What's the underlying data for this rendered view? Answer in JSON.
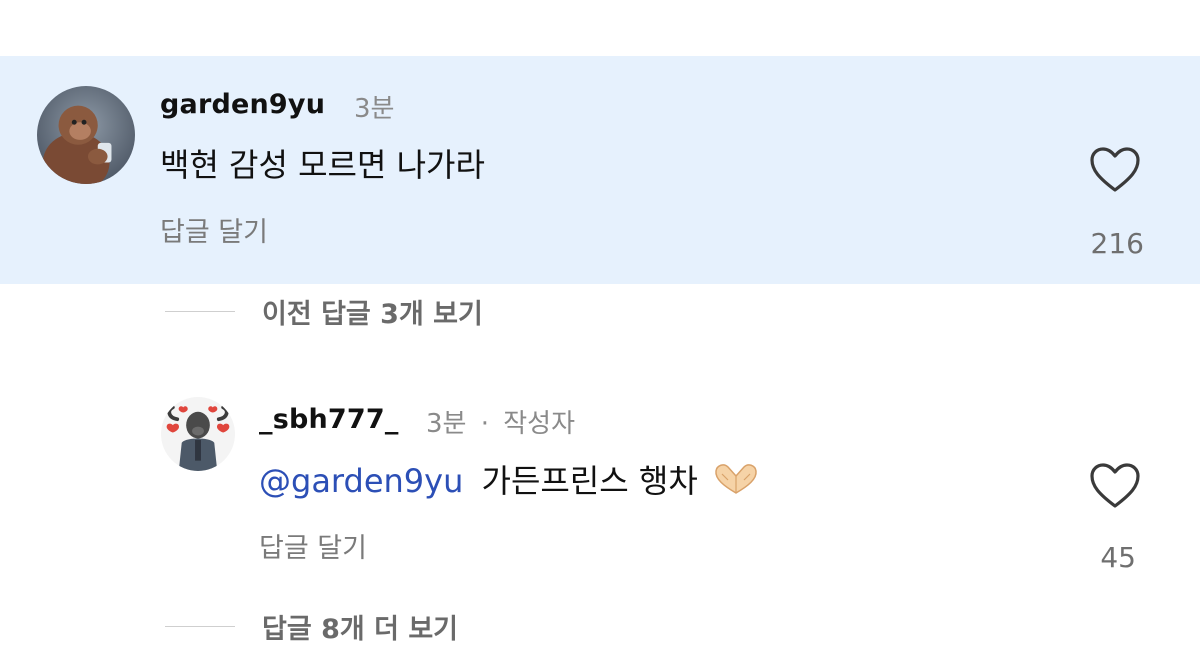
{
  "comments": [
    {
      "username": "garden9yu",
      "time": "3분",
      "text": "백현 감성 모르면 나가라",
      "reply_label": "답글 달기",
      "likes": "216",
      "avatar_icon": "gorilla-avatar-icon"
    },
    {
      "username": "_sbh777_",
      "time": "3분",
      "separator": "·",
      "author_badge": "작성자",
      "mention": "@garden9yu",
      "text": "가든프린스 행차",
      "emoji_icon": "heart-hands-emoji-icon",
      "reply_label": "답글 달기",
      "likes": "45",
      "avatar_icon": "buffalo-avatar-icon"
    }
  ],
  "threads": {
    "previous_replies": "이전 답글 3개 보기",
    "more_replies": "답글 8개 더 보기"
  },
  "colors": {
    "highlight": "#e6f1fd",
    "mention": "#2c4fb6"
  }
}
